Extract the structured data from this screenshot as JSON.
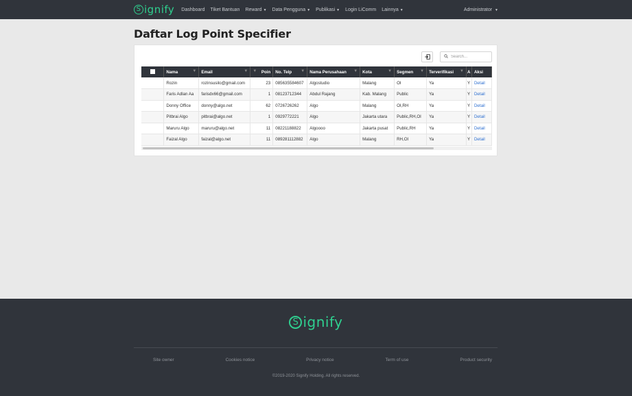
{
  "brand": {
    "logo_letter": "S",
    "logo_rest": "ignify"
  },
  "nav": {
    "items": [
      {
        "label": "Dashboard",
        "dropdown": false
      },
      {
        "label": "Tiket Bantuan",
        "dropdown": false
      },
      {
        "label": "Reward",
        "dropdown": true
      },
      {
        "label": "Data Pengguna",
        "dropdown": true
      },
      {
        "label": "Publikasi",
        "dropdown": true
      },
      {
        "label": "Login LiComm",
        "dropdown": false
      },
      {
        "label": "Lainnya",
        "dropdown": true
      }
    ],
    "user": "Administrator"
  },
  "page": {
    "title": "Daftar Log Point Specifier"
  },
  "toolbar": {
    "search_placeholder": "Search..."
  },
  "table": {
    "columns": [
      "Nama",
      "Email",
      "Poin",
      "No. Telp",
      "Nama Perusahaan",
      "Kota",
      "Segmen",
      "Terverifikasi",
      "A",
      "Aksi"
    ],
    "rows": [
      [
        "Rozin",
        "rozinsusilo@gmail.com",
        "23",
        "085635584607",
        "Algostudio",
        "Malang",
        "OI",
        "Ya",
        "Y",
        "Detail"
      ],
      [
        "Faris Adlan Aa",
        "farisdx66@gmail.com",
        "1",
        "08123712344",
        "Abdul Rajang",
        "Kab. Malang",
        "Public",
        "Ya",
        "Y",
        "Detail"
      ],
      [
        "Donny Office",
        "donny@algo.net",
        "62",
        "0726726262",
        "Algo",
        "Malang",
        "OI,RH",
        "Ya",
        "Y",
        "Detail"
      ],
      [
        "Pitbrai Algo",
        "pitbrai@algo.net",
        "1",
        "0929772221",
        "Algo",
        "Jakarta utara",
        "Public,RH,OI",
        "Ya",
        "Y",
        "Detail"
      ],
      [
        "Maruru Algo",
        "maruru@algo.net",
        "11",
        "08221188822",
        "Algoooo",
        "Jakarta pusat",
        "Public,RH",
        "Ya",
        "Y",
        "Detail"
      ],
      [
        "Faizal Algo",
        "faizal@algo.net",
        "11",
        "089281112882",
        "Algo",
        "Malang",
        "RH,OI",
        "Ya",
        "Y",
        "Detail"
      ]
    ]
  },
  "footer": {
    "links": [
      "Site owner",
      "Cookies notice",
      "Privacy notice",
      "Term of use",
      "Product security"
    ],
    "copyright": "©2019-2020 Signify Holding. All rights reserved."
  },
  "colors": {
    "brand": "#2fcf8f",
    "dark": "#30343b",
    "link": "#2d6fd0"
  }
}
